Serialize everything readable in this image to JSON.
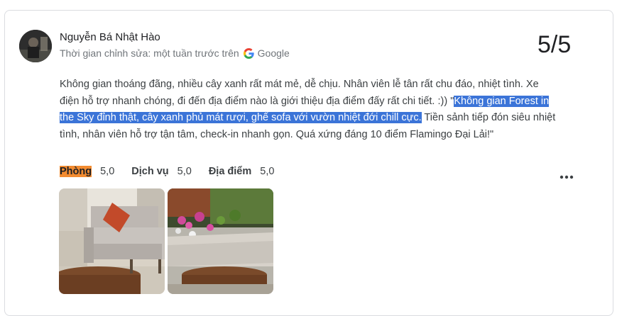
{
  "review": {
    "reviewer_name": "Nguyễn Bá Nhật Hào",
    "edit_time": "Thời gian chỉnh sửa: một tuần trước trên",
    "source": "Google",
    "score": "5/5",
    "text_part1": "Không gian thoáng đãng, nhiều cây xanh rất mát mẻ, dễ chịu. Nhân viên lễ tân rất chu đáo, nhiệt tình. Xe điện hỗ trợ nhanh chóng, đi đến địa điểm nào là giới thiệu địa điểm đấy rất chi tiết. :)) \"",
    "text_highlight": "Không gian Forest in the Sky đỉnh thật, cây xanh phủ mát rượi, ghế sofa với vườn nhiệt đới chill cực.",
    "text_part2": " Tiền sảnh tiếp đón siêu nhiệt tình, nhân viên hỗ trợ tận tâm, check-in nhanh gọn. Quá xứng đáng 10 điểm Flamingo Đại Lải!\"",
    "ratings": [
      {
        "label": "Phòng",
        "value": "5,0"
      },
      {
        "label": "Dịch vụ",
        "value": "5,0"
      },
      {
        "label": "Địa điểm",
        "value": "5,0"
      }
    ]
  },
  "colors": {
    "highlight_bg": "#3b74d8",
    "room_label_bg": "#f28b30",
    "meta_text": "#70757a"
  },
  "icons": [
    "google-g-icon",
    "more-options-icon"
  ]
}
